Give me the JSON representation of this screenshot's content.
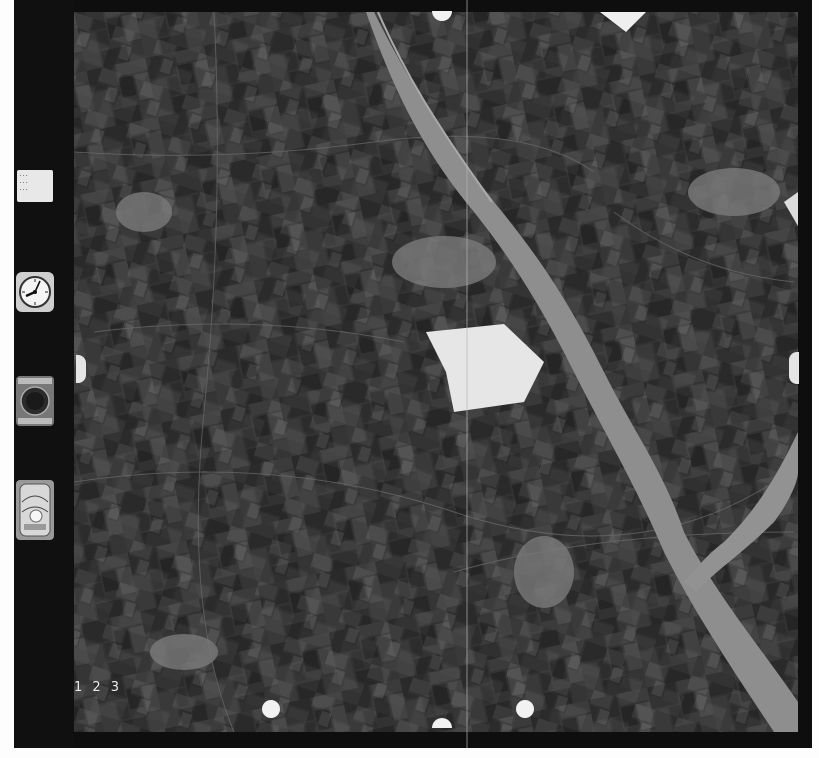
{
  "instrument_strip": {
    "notes_card_lines": [
      "...",
      "...",
      "..."
    ],
    "frame_number": "1 2 3"
  },
  "icons": {
    "clock": "clock-icon",
    "altimeter": "altimeter-icon",
    "level": "bubble-level-icon"
  },
  "colors": {
    "film_border": "#0e0e0e",
    "river": "#8e8e8e",
    "fields_dark": "#2a2a2a",
    "fields_light": "#5a5a5a",
    "blank_patch": "#e6e6e6"
  }
}
